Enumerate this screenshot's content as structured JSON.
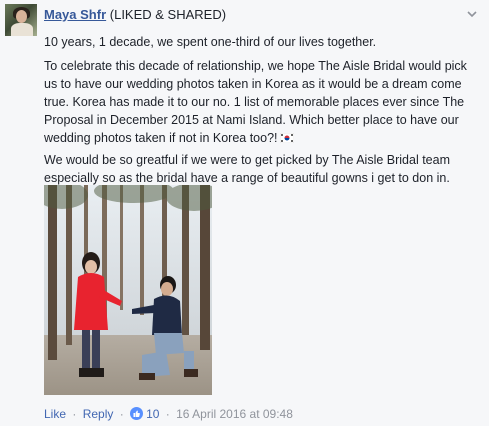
{
  "comment": {
    "author": "Maya Shfr",
    "tag": "(LIKED & SHARED)",
    "paragraphs": {
      "p1": "10 years, 1 decade, we spent one-third of our lives together.",
      "p2": "To celebrate this decade of relationship, we hope The Aisle Bridal would pick us to have our wedding photos taken in Korea as it would be a dream come true. Korea has made it to our no. 1 list of memorable places ever since The Proposal in December 2015 at Nami Island. Which better place to have our wedding photos taken if not in Korea too?!",
      "p3": "We would be so greatful if we were to get picked by The Aisle Bridal team especially so as the bridal have a range of beautiful gowns i get to don in."
    },
    "flag_icon": "south-korea-flag-icon"
  },
  "actions": {
    "like": "Like",
    "reply": "Reply",
    "separator": "·",
    "like_count": "10",
    "timestamp": "16 April 2016 at 09:48"
  },
  "colors": {
    "link": "#365899",
    "action_link": "#4267b2",
    "like_badge": "#5890ff",
    "background": "#f6f7f9"
  }
}
